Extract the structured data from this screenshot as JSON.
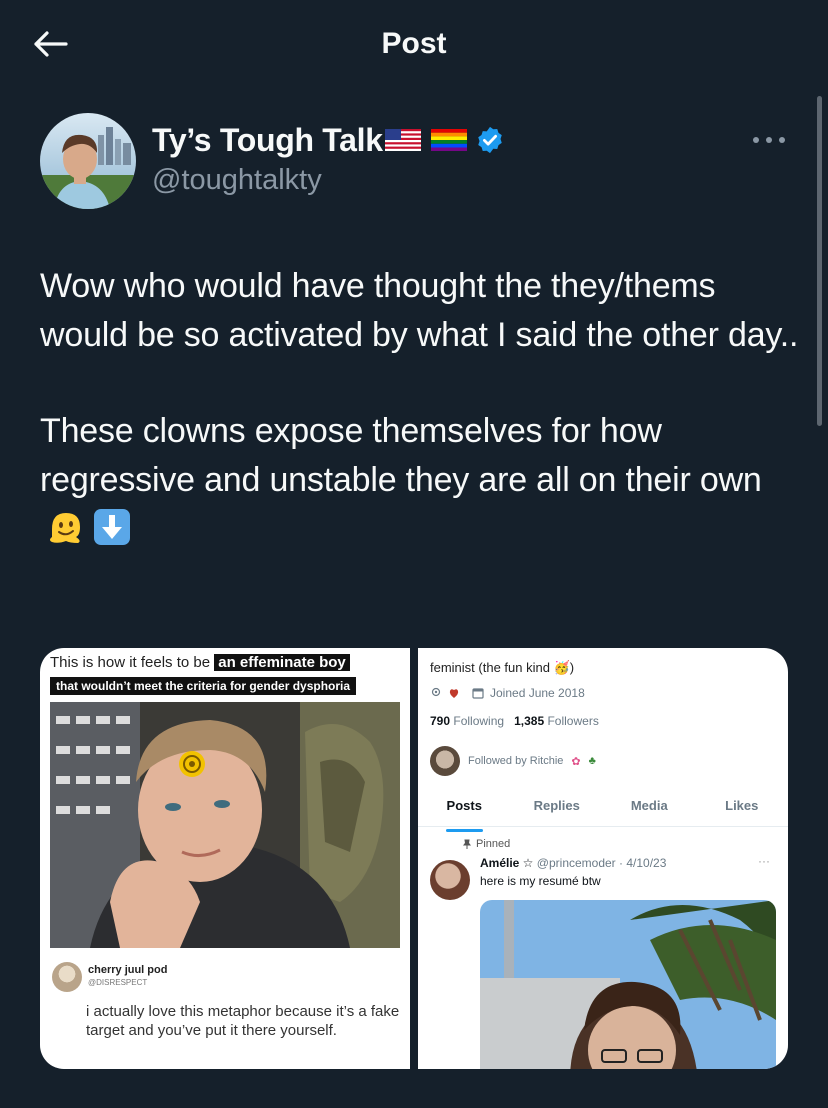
{
  "header": {
    "title": "Post",
    "back_icon": "arrow-left-icon"
  },
  "author": {
    "display_name": "Ty’s Tough Talk",
    "handle": "@toughtalkty",
    "badges": [
      "us-flag-emoji",
      "rainbow-flag-emoji",
      "verified-badge-icon"
    ],
    "verified_color": "#1d9bf0"
  },
  "post": {
    "paragraph1": "Wow who would have thought the they/thems would be so activated by what I said the other day..",
    "paragraph2": "These clowns expose themselves for how regressive and unstable they are all on their own",
    "trailing_emojis": [
      "melting-face-emoji",
      "down-arrow-emoji"
    ]
  },
  "media": {
    "left_image": {
      "caption_line1": "This is how it feels to be",
      "caption_highlight": "an effeminate boy",
      "caption_line2": "that wouldn’t meet the criteria for gender dysphoria",
      "reply_name": "cherry juul pod",
      "reply_handle": "@DISRESPECT",
      "reply_text": "i actually love this metaphor because it’s a fake target and you’ve put it there yourself."
    },
    "right_image": {
      "bio": "feminist (the fun kind 🥳)",
      "joined": "Joined June 2018",
      "following_count": "790",
      "following_label": "Following",
      "followers_count": "1,385",
      "followers_label": "Followers",
      "followed_by": "Followed by Ritchie",
      "tabs": [
        "Posts",
        "Replies",
        "Media",
        "Likes"
      ],
      "active_tab": "Posts",
      "pinned_label": "Pinned",
      "post_author": "Amélie ☆",
      "post_handle_date": "@princemoder · 4/10/23",
      "post_text": "here is my resumé btw",
      "more": "···"
    }
  },
  "colors": {
    "background": "#15202b",
    "text": "#f7f9f9",
    "secondary_text": "#8b98a5",
    "accent": "#1d9bf0"
  }
}
